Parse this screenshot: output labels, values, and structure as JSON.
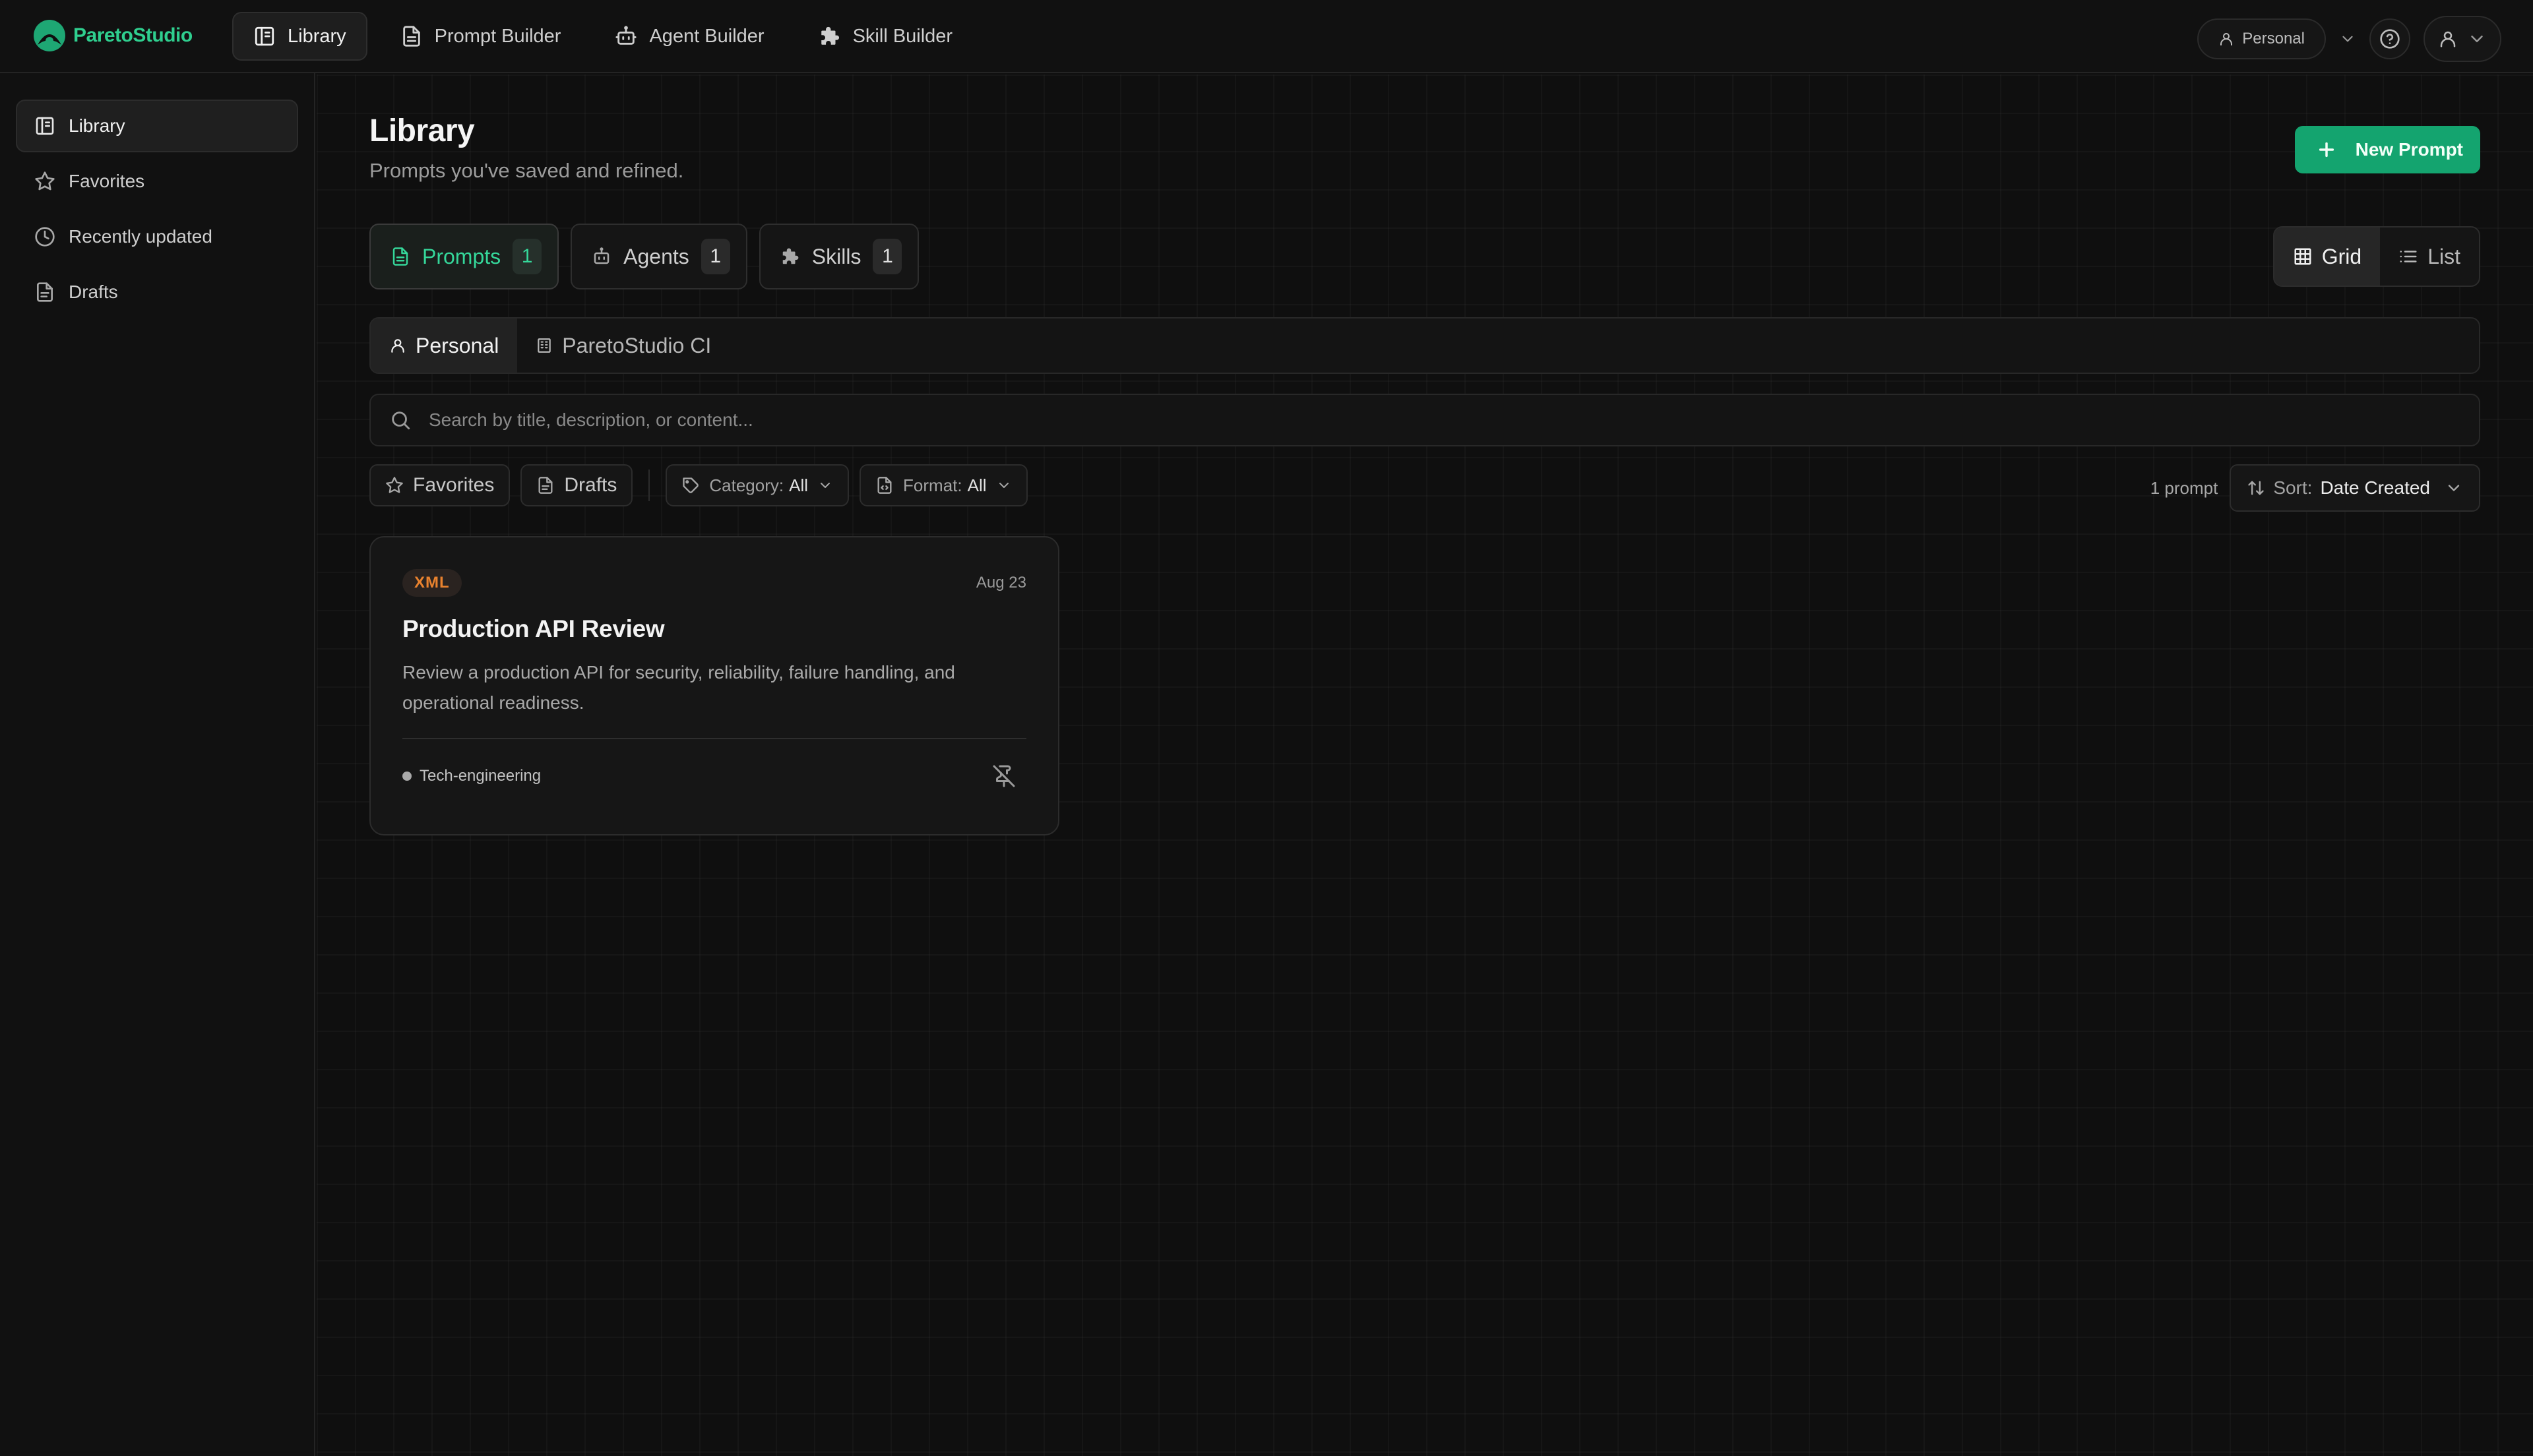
{
  "app": {
    "name": "ParetoStudio",
    "accent": "#14a46f"
  },
  "topnav": [
    {
      "label": "Library",
      "icon": "library-icon",
      "active": true
    },
    {
      "label": "Prompt Builder",
      "icon": "file-text-icon",
      "active": false
    },
    {
      "label": "Agent Builder",
      "icon": "bot-icon",
      "active": false
    },
    {
      "label": "Skill Builder",
      "icon": "puzzle-icon",
      "active": false
    }
  ],
  "workspace": {
    "label": "Personal"
  },
  "sidebar": {
    "items": [
      {
        "label": "Library",
        "icon": "library-icon",
        "active": true
      },
      {
        "label": "Favorites",
        "icon": "star-icon",
        "active": false
      },
      {
        "label": "Recently updated",
        "icon": "clock-icon",
        "active": false
      },
      {
        "label": "Drafts",
        "icon": "file-icon",
        "active": false
      }
    ]
  },
  "header": {
    "title": "Library",
    "subtitle": "Prompts you've saved and refined.",
    "new_button": "New Prompt"
  },
  "type_tabs": [
    {
      "label": "Prompts",
      "count": "1",
      "active": true
    },
    {
      "label": "Agents",
      "count": "1",
      "active": false
    },
    {
      "label": "Skills",
      "count": "1",
      "active": false
    }
  ],
  "view_toggle": {
    "grid": "Grid",
    "list": "List",
    "selected": "Grid"
  },
  "scope": [
    {
      "label": "Personal",
      "active": true
    },
    {
      "label": "ParetoStudio CI",
      "active": false
    }
  ],
  "search": {
    "placeholder": "Search by title, description, or content...",
    "value": ""
  },
  "filters": {
    "favorites": "Favorites",
    "drafts": "Drafts",
    "category_key": "Category:",
    "category_val": "All",
    "format_key": "Format:",
    "format_val": "All"
  },
  "results": {
    "count_label": "1 prompt"
  },
  "sort": {
    "key": "Sort:",
    "value": "Date Created"
  },
  "cards": [
    {
      "format": "XML",
      "format_color": "#e9822e",
      "date": "Aug 23",
      "title": "Production API Review",
      "description": "Review a production API for security, reliability, failure handling, and operational readiness.",
      "tag": "Tech-engineering"
    }
  ]
}
